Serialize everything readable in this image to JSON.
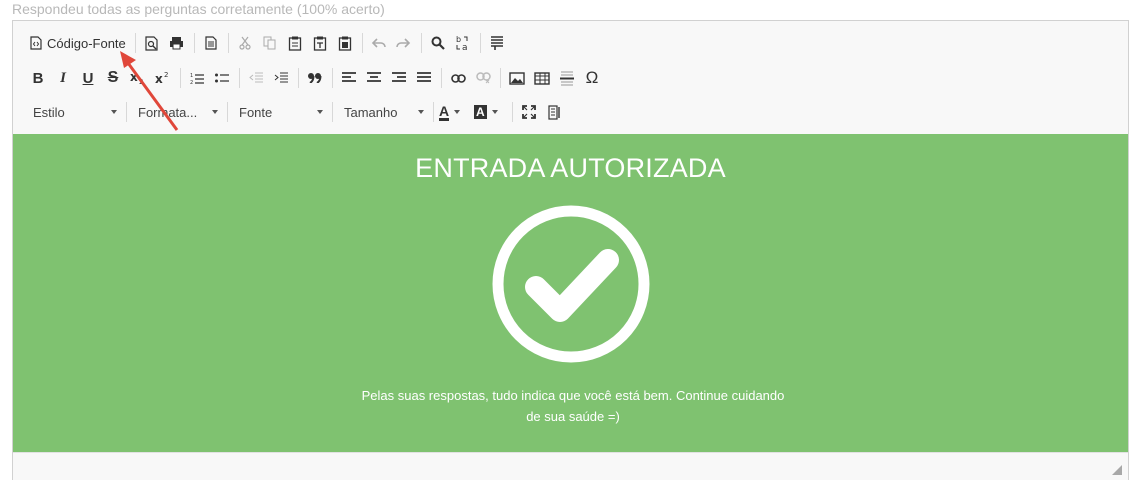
{
  "caption": "Respondeu todas as perguntas corretamente (100% acerto)",
  "toolbar": {
    "source_label": "Código-Fonte",
    "style_combo": "Estilo",
    "format_combo": "Formata...",
    "font_combo": "Fonte",
    "size_combo": "Tamanho",
    "bold": "B",
    "italic": "I",
    "underline": "U",
    "strike": "S",
    "omega": "Ω",
    "text_color_letter": "A",
    "bg_color_letter": "A"
  },
  "content": {
    "title": "ENTRADA AUTORIZADA",
    "message": "Pelas suas respostas, tudo indica que você está bem. Continue cuidando de sua saúde =)",
    "background_color": "#7fc270"
  },
  "colors": {
    "annotation_arrow": "#e0473a"
  }
}
